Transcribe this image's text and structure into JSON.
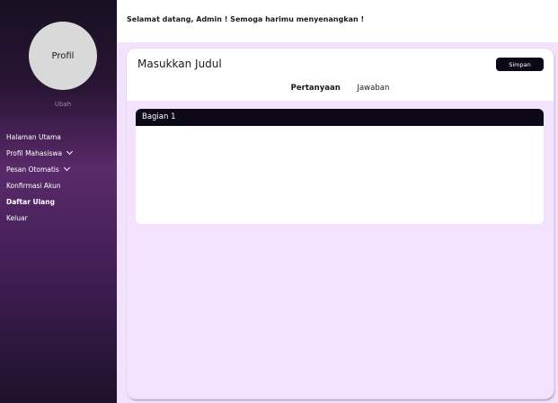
{
  "sidebar": {
    "profile_label": "Profil",
    "edit_label": "Ubah",
    "items": [
      {
        "label": "Halaman Utama"
      },
      {
        "label": "Profil Mahasiswa"
      },
      {
        "label": "Pesan Otomatis"
      },
      {
        "label": "Konfirmasi Akun"
      },
      {
        "label": "Daftar Ulang"
      },
      {
        "label": "Keluar"
      }
    ],
    "active_item": "Daftar Ulang"
  },
  "header": {
    "welcome": "Selamat datang, Admin ! Semoga harimu menyenangkan !"
  },
  "form": {
    "title_placeholder": "Masukkan Judul",
    "save_label": "Simpan",
    "tabs": [
      {
        "label": "Pertanyaan"
      },
      {
        "label": "Jawaban"
      }
    ],
    "active_tab": "Pertanyaan",
    "section_title": "Bagian 1"
  },
  "colors": {
    "sidebar_gradient_mid": "#5a2a6a",
    "dark_accent": "#0d0818",
    "main_background": "#f3e2fc",
    "edit_link": "#9b8aa6"
  },
  "icons": {
    "dropdown": "chevron-down-icon"
  }
}
